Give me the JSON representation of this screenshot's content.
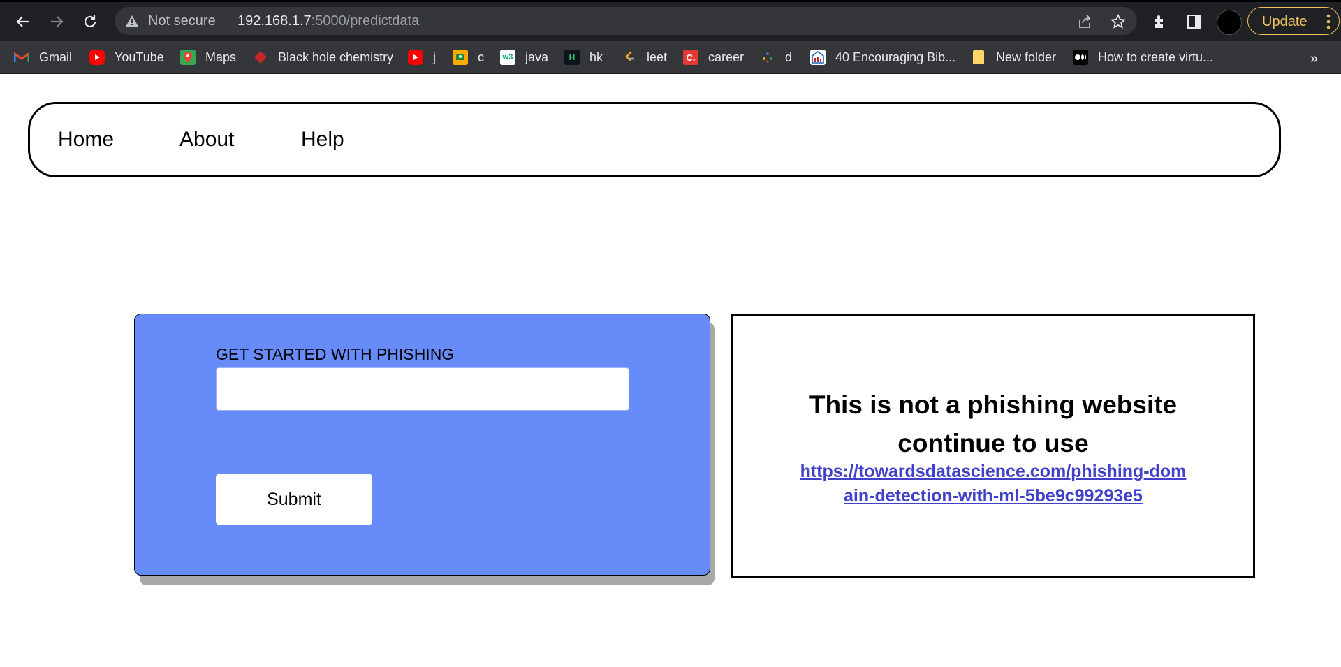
{
  "browser": {
    "security_label": "Not secure",
    "url_host": "192.168.1.7",
    "url_path": ":5000/predictdata",
    "update_label": "Update",
    "bookmarks": [
      {
        "label": "Gmail",
        "icon": "gmail-icon",
        "color": "#ea4335"
      },
      {
        "label": "YouTube",
        "icon": "youtube-icon",
        "color": "#ff0000"
      },
      {
        "label": "Maps",
        "icon": "maps-icon",
        "color": "#34a853"
      },
      {
        "label": "Black hole chemistry",
        "icon": "bookmark-red-icon",
        "color": "#c62828"
      },
      {
        "label": "j",
        "icon": "youtube-icon",
        "color": "#ff0000"
      },
      {
        "label": "c",
        "icon": "classroom-icon",
        "color": "#f9ab00"
      },
      {
        "label": "java",
        "icon": "w3-icon",
        "color": "#ffffff"
      },
      {
        "label": "hk",
        "icon": "hackerrank-icon",
        "color": "#0e141e"
      },
      {
        "label": "leet",
        "icon": "leetcode-icon",
        "color": "#f89f1b"
      },
      {
        "label": "career",
        "icon": "codechef-icon",
        "color": "#e53935"
      },
      {
        "label": "d",
        "icon": "dots-icon",
        "color": "#4285f4"
      },
      {
        "label": "40 Encouraging Bib...",
        "icon": "bible-site-icon",
        "color": "#ffffff"
      },
      {
        "label": "New folder",
        "icon": "folder-icon",
        "color": "#fdd663"
      },
      {
        "label": "How to create virtu...",
        "icon": "medium-icon",
        "color": "#000000"
      }
    ]
  },
  "nav": {
    "home": "Home",
    "about": "About",
    "help": "Help"
  },
  "form": {
    "label": "GET STARTED WITH PHISHING",
    "input_value": "",
    "submit_label": "Submit"
  },
  "result": {
    "line1": "This is not a phishing website",
    "line2": "continue to use",
    "link": "https://towardsdatascience.com/phishing-domain-detection-with-ml-5be9c99293e5"
  },
  "colors": {
    "card_bg": "#678cfa",
    "link": "#4040c8",
    "update_accent": "#f0c35b"
  }
}
